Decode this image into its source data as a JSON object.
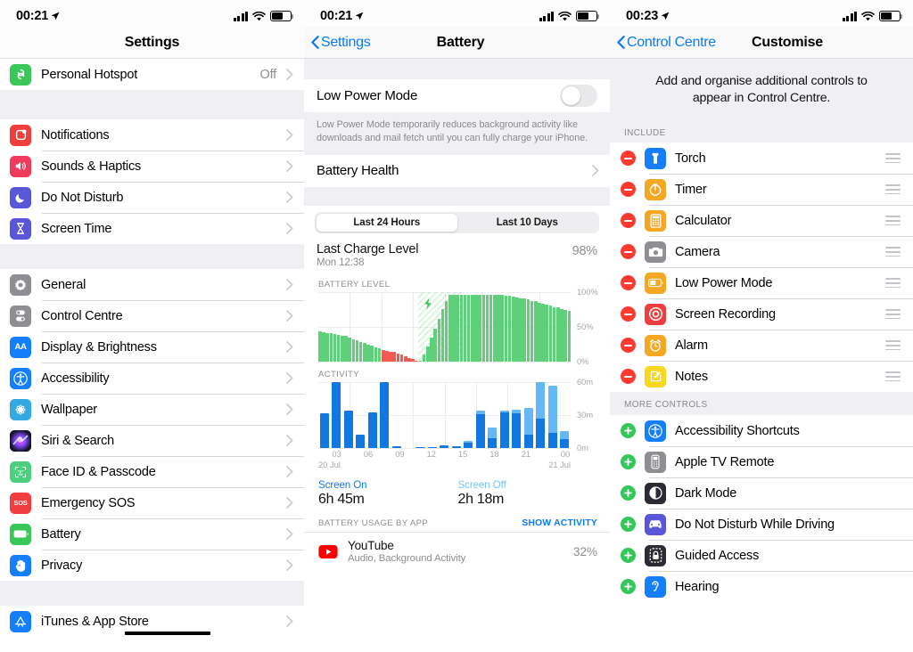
{
  "panels": {
    "settings": {
      "status": {
        "time": "00:21"
      },
      "nav": {
        "title": "Settings"
      },
      "group1": [
        {
          "label": "Personal Hotspot",
          "value": "Off",
          "icon": "hotspot-icon",
          "color": "#3ac75a"
        }
      ],
      "group2": [
        {
          "label": "Notifications",
          "icon": "notifications-icon",
          "color": "#f03e3e"
        },
        {
          "label": "Sounds & Haptics",
          "icon": "sounds-icon",
          "color": "#ef3b5b"
        },
        {
          "label": "Do Not Disturb",
          "icon": "moon-icon",
          "color": "#5957d7"
        },
        {
          "label": "Screen Time",
          "icon": "hourglass-icon",
          "color": "#5957d7"
        }
      ],
      "group3": [
        {
          "label": "General",
          "icon": "gear-icon",
          "color": "#8e8e93"
        },
        {
          "label": "Control Centre",
          "icon": "control-centre-icon",
          "color": "#8e8e93"
        },
        {
          "label": "Display & Brightness",
          "icon": "display-icon",
          "color": "#157efb"
        },
        {
          "label": "Accessibility",
          "icon": "accessibility-icon",
          "color": "#157efb"
        },
        {
          "label": "Wallpaper",
          "icon": "wallpaper-icon",
          "color": "#34a8e0"
        },
        {
          "label": "Siri & Search",
          "icon": "siri-icon",
          "color": "#2b2b33"
        },
        {
          "label": "Face ID & Passcode",
          "icon": "face-id-icon",
          "color": "#4cd07d"
        },
        {
          "label": "Emergency SOS",
          "icon": "sos-icon",
          "color": "#f03e3e"
        },
        {
          "label": "Battery",
          "icon": "battery-icon",
          "color": "#3ac75a"
        },
        {
          "label": "Privacy",
          "icon": "privacy-hand-icon",
          "color": "#157efb"
        }
      ],
      "group4": [
        {
          "label": "iTunes & App Store",
          "icon": "app-store-icon",
          "color": "#157efb"
        }
      ]
    },
    "battery": {
      "status": {
        "time": "00:21"
      },
      "nav": {
        "back": "Settings",
        "title": "Battery"
      },
      "low_power": {
        "label": "Low Power Mode",
        "on": false
      },
      "low_power_footnote": "Low Power Mode temporarily reduces background activity like downloads and mail fetch until you can fully charge your iPhone.",
      "battery_health": {
        "label": "Battery Health"
      },
      "segmented": {
        "options": [
          "Last 24 Hours",
          "Last 10 Days"
        ],
        "selected": "Last 24 Hours"
      },
      "last_charge": {
        "title": "Last Charge Level",
        "subtitle": "Mon 12:38",
        "percent": "98%"
      },
      "screen": {
        "on_label": "Screen On",
        "on_value": "6h 45m",
        "off_label": "Screen Off",
        "off_value": "2h 18m"
      },
      "usage": {
        "header": "BATTERY USAGE BY APP",
        "action": "SHOW ACTIVITY"
      },
      "apps": [
        {
          "name": "YouTube",
          "subtitle": "Audio, Background Activity",
          "percent": "32%",
          "icon": "youtube-icon",
          "color": "#ff0000"
        }
      ]
    },
    "customise": {
      "status": {
        "time": "00:23"
      },
      "nav": {
        "back": "Control Centre",
        "title": "Customise"
      },
      "intro": "Add and organise additional controls to appear in Control Centre.",
      "include_header": "INCLUDE",
      "include": [
        {
          "label": "Torch",
          "icon": "torch-icon",
          "color": "#157efb"
        },
        {
          "label": "Timer",
          "icon": "timer-icon",
          "color": "#f5a623"
        },
        {
          "label": "Calculator",
          "icon": "calculator-icon",
          "color": "#f5a623"
        },
        {
          "label": "Camera",
          "icon": "camera-icon",
          "color": "#8e8e93"
        },
        {
          "label": "Low Power Mode",
          "icon": "low-power-icon",
          "color": "#f5a623"
        },
        {
          "label": "Screen Recording",
          "icon": "screen-recording-icon",
          "color": "#f03e3e"
        },
        {
          "label": "Alarm",
          "icon": "alarm-icon",
          "color": "#f5a623"
        },
        {
          "label": "Notes",
          "icon": "notes-icon",
          "color": "#f9d71c"
        }
      ],
      "more_header": "MORE CONTROLS",
      "more": [
        {
          "label": "Accessibility Shortcuts",
          "icon": "accessibility-icon",
          "color": "#157efb"
        },
        {
          "label": "Apple TV Remote",
          "icon": "apple-tv-remote-icon",
          "color": "#8e8e93"
        },
        {
          "label": "Dark Mode",
          "icon": "dark-mode-icon",
          "color": "#2b2b33"
        },
        {
          "label": "Do Not Disturb While Driving",
          "icon": "car-icon",
          "color": "#5957d7"
        },
        {
          "label": "Guided Access",
          "icon": "guided-access-icon",
          "color": "#2b2b33"
        },
        {
          "label": "Hearing",
          "icon": "hearing-icon",
          "color": "#157efb"
        }
      ]
    }
  },
  "chart_data": [
    {
      "type": "bar",
      "title": "BATTERY LEVEL",
      "ylabel": "",
      "xlabel": "",
      "ylim": [
        0,
        100
      ],
      "ytick_labels": [
        "100%",
        "50%",
        "0%"
      ],
      "ytick_values": [
        100,
        50,
        0
      ],
      "xtick_labels": [
        "03",
        "06",
        "09",
        "12",
        "15",
        "18",
        "21",
        "00"
      ],
      "x_start_date": "20 Jul",
      "x_end_date": "21 Jul",
      "legend": [
        "discharging (green)",
        "low battery (red)",
        "charging band"
      ],
      "colors": {
        "green": "#5ed07a",
        "red": "#f05a52",
        "charge_band": "#b9e9c3"
      },
      "charging_band": {
        "start_index": 27,
        "end_index": 34
      },
      "values": [
        44,
        43,
        42,
        41,
        40,
        39,
        38,
        37,
        35,
        33,
        31,
        29,
        27,
        25,
        23,
        21,
        19,
        17,
        16,
        15,
        14,
        12,
        10,
        8,
        6,
        4,
        2,
        1,
        10,
        22,
        35,
        48,
        62,
        76,
        88,
        96,
        97,
        97,
        97,
        97,
        97,
        97,
        97,
        97,
        97,
        97,
        97,
        97,
        96,
        96,
        95,
        95,
        94,
        93,
        92,
        91,
        90,
        88,
        87,
        85,
        84,
        82,
        81,
        79,
        78,
        76,
        75,
        74
      ],
      "red_from_index": 17,
      "red_to_index": 27
    },
    {
      "type": "bar",
      "title": "ACTIVITY",
      "stacked": true,
      "ylabel": "",
      "xlabel": "",
      "ylim": [
        0,
        60
      ],
      "ytick_labels": [
        "60m",
        "30m",
        "0m"
      ],
      "ytick_values": [
        60,
        30,
        0
      ],
      "xtick_labels": [
        "03",
        "06",
        "09",
        "12",
        "15",
        "18",
        "21",
        "00"
      ],
      "x_start_date": "20 Jul",
      "x_end_date": "21 Jul",
      "series": [
        {
          "name": "Screen On",
          "color": "#1178e0",
          "values": [
            32,
            60,
            34,
            12,
            33,
            60,
            2,
            0,
            1,
            1,
            3,
            2,
            5,
            31,
            9,
            33,
            32,
            12,
            27,
            14,
            8
          ]
        },
        {
          "name": "Screen Off",
          "color": "#63b8f5",
          "values": [
            0,
            0,
            0,
            0,
            0,
            0,
            0,
            0,
            0,
            0,
            0,
            0,
            2,
            3,
            10,
            1,
            3,
            25,
            33,
            43,
            8
          ]
        }
      ],
      "categories": [
        "02",
        "03",
        "04",
        "05",
        "06",
        "07",
        "08",
        "09",
        "11",
        "12",
        "13",
        "14",
        "15",
        "16",
        "17",
        "18",
        "19",
        "20",
        "21",
        "22",
        "23"
      ]
    }
  ]
}
